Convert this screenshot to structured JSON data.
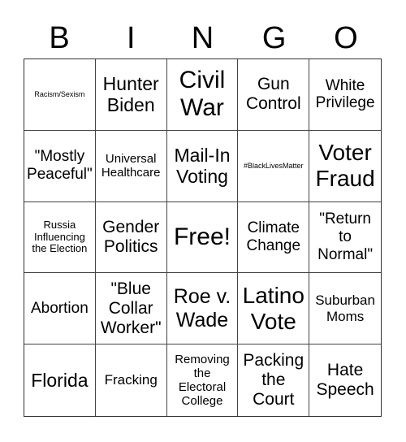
{
  "header": [
    "B",
    "I",
    "N",
    "G",
    "O"
  ],
  "cells": [
    [
      "Racism/Sexism",
      "Hunter Biden",
      "Civil War",
      "Gun Control",
      "White Privilege"
    ],
    [
      "\"Mostly Peaceful\"",
      "Universal Healthcare",
      "Mail-In Voting",
      "#BlackLivesMatter",
      "Voter Fraud"
    ],
    [
      "Russia Influencing the Election",
      "Gender Politics",
      "Free!",
      "Climate Change",
      "\"Return to Normal\""
    ],
    [
      "Abortion",
      "\"Blue Collar Worker\"",
      "Roe v. Wade",
      "Latino Vote",
      "Suburban Moms"
    ],
    [
      "Florida",
      "Fracking",
      "Removing the Electoral College",
      "Packing the Court",
      "Hate Speech"
    ]
  ]
}
